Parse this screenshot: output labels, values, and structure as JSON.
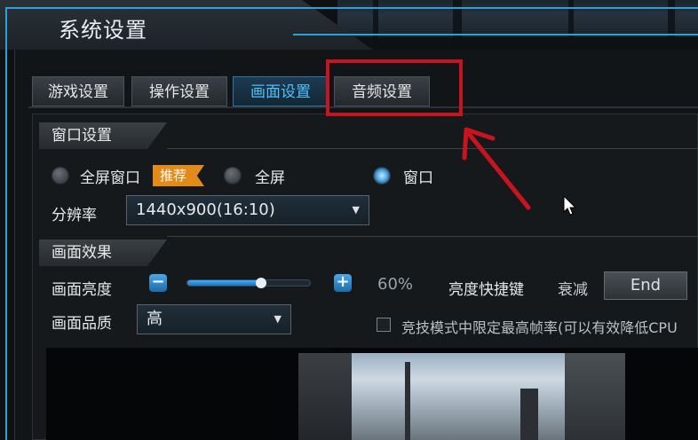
{
  "window": {
    "title": "系统设置"
  },
  "tabs": [
    {
      "label": "游戏设置",
      "active": false
    },
    {
      "label": "操作设置",
      "active": false
    },
    {
      "label": "画面设置",
      "active": true
    },
    {
      "label": "音频设置",
      "active": false
    }
  ],
  "window_settings": {
    "header": "窗口设置",
    "display_modes": [
      {
        "label": "全屏窗口",
        "selected": false
      },
      {
        "label": "全屏",
        "selected": false
      },
      {
        "label": "窗口",
        "selected": true
      }
    ],
    "recommend_badge": "推荐",
    "resolution_label": "分辨率",
    "resolution_value": "1440x900(16:10)"
  },
  "picture_effects": {
    "header": "画面效果",
    "brightness_label": "画面亮度",
    "brightness_percent": "60%",
    "brightness_value": 0.6,
    "hotkey_label": "亮度快捷键",
    "dim_label": "衰减",
    "dim_key": "End",
    "quality_label": "画面品质",
    "quality_value": "高",
    "framerate_checkbox_label": "竞技模式中限定最高帧率(可以有效降低CPU",
    "framerate_checked": false
  },
  "colors": {
    "accent": "#2f9fd6",
    "active_tab_text": "#4fc0ff",
    "badge": "#e28a1a",
    "annotation": "#c8141e"
  },
  "icons": {
    "dropdown": "chevron-down-icon",
    "minus": "minus-icon",
    "plus": "plus-icon",
    "annotation_arrow": "arrow-icon",
    "cursor": "mouse-cursor-icon"
  }
}
